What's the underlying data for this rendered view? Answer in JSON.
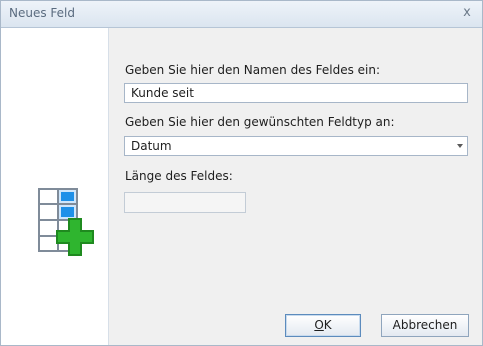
{
  "window": {
    "title": "Neues Feld",
    "close_glyph": "x"
  },
  "form": {
    "name_label": "Geben Sie hier den Namen des Feldes ein:",
    "name_value": "Kunde seit",
    "type_label": "Geben Sie hier den gewünschten Feldtyp an:",
    "type_value": "Datum",
    "length_label": "Länge des Feldes:",
    "length_value": ""
  },
  "buttons": {
    "ok_underlined": "O",
    "ok_rest": "K",
    "cancel": "Abbrechen"
  },
  "icon": {
    "name": "table-add-field-icon",
    "grid_color": "#7f8b99",
    "cell_highlight": "#1e90e8",
    "plus_color": "#2fb52f"
  }
}
